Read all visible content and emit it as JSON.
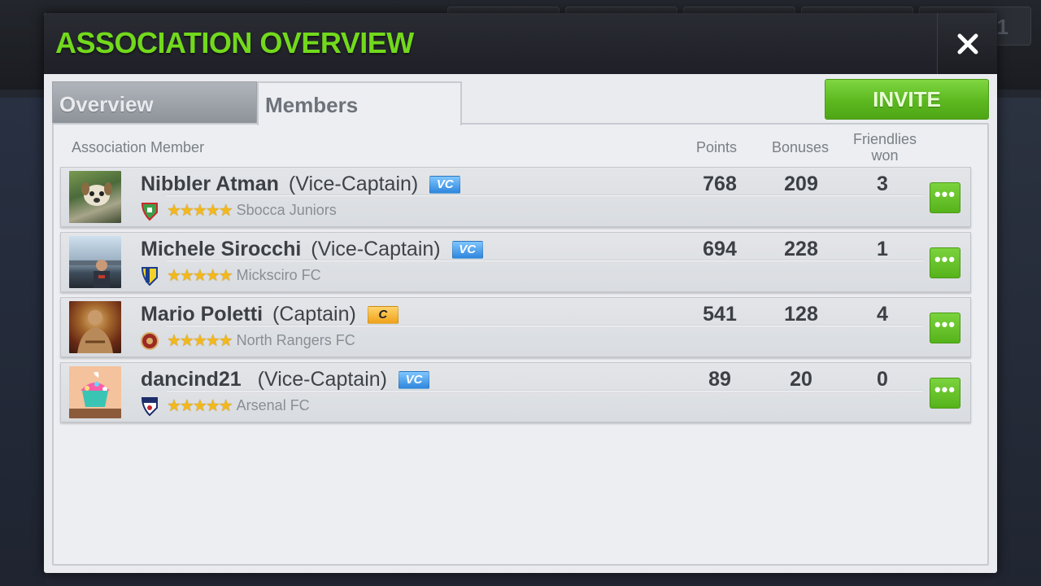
{
  "modal": {
    "title": "ASSOCIATION OVERVIEW",
    "close_icon": "close-icon"
  },
  "background": {
    "corner_text": "1"
  },
  "tabs": [
    {
      "label": "Overview",
      "active": false
    },
    {
      "label": "Members",
      "active": true
    }
  ],
  "invite_label": "INVITE",
  "columns": {
    "member": "Association Member",
    "points": "Points",
    "bonuses": "Bonuses",
    "friendlies_line1": "Friendlies",
    "friendlies_line2": "won"
  },
  "members": [
    {
      "name": "Nibbler Atman",
      "role": "(Vice-Captain)",
      "badge": "VC",
      "club": "Sbocca Juniors",
      "stars": "★★★★★",
      "points": "768",
      "bonuses": "209",
      "friendlies": "3",
      "more": "•••"
    },
    {
      "name": "Michele Sirocchi",
      "role": "(Vice-Captain)",
      "badge": "VC",
      "club": "Micksciro FC",
      "stars": "★★★★★",
      "points": "694",
      "bonuses": "228",
      "friendlies": "1",
      "more": "•••"
    },
    {
      "name": "Mario Poletti",
      "role": "(Captain)",
      "badge": "C",
      "club": "North Rangers FC",
      "stars": "★★★★★",
      "points": "541",
      "bonuses": "128",
      "friendlies": "4",
      "more": "•••"
    },
    {
      "name": "dancind21",
      "role": "(Vice-Captain)",
      "badge": "VC",
      "club": "Arsenal FC",
      "stars": "★★★★★",
      "points": "89",
      "bonuses": "20",
      "friendlies": "0",
      "more": "•••"
    }
  ],
  "colors": {
    "title_green": "#72d91c",
    "button_green": "#5cb820",
    "vc_badge": "#2f86dd",
    "c_badge": "#f0a21a",
    "star_gold": "#f2b81c"
  }
}
